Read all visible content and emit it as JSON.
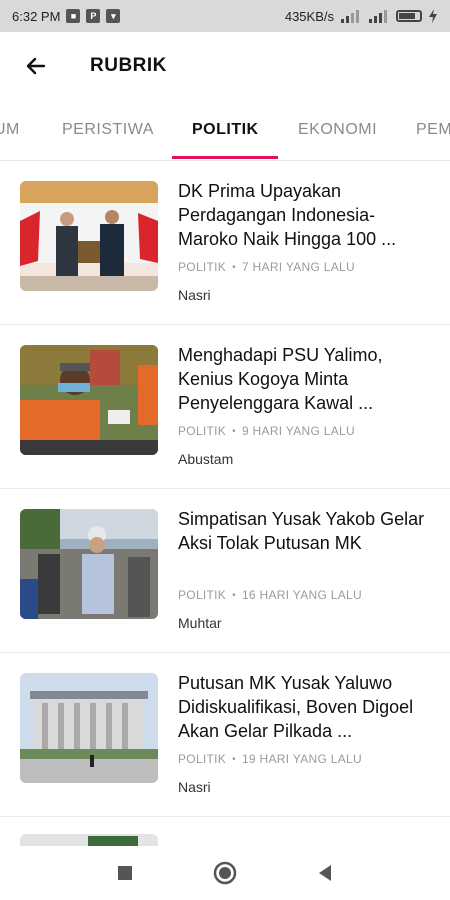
{
  "status_bar": {
    "time": "6:32 PM",
    "speed": "435KB/s",
    "network_label": "4G"
  },
  "app_bar": {
    "title": "RUBRIK",
    "back_icon": "arrow-left-icon"
  },
  "tabs": [
    {
      "label": "UM",
      "active": false
    },
    {
      "label": "PERISTIWA",
      "active": false
    },
    {
      "label": "POLITIK",
      "active": true
    },
    {
      "label": "EKONOMI",
      "active": false
    },
    {
      "label": "PEM",
      "active": false
    }
  ],
  "articles": [
    {
      "title": "DK Prima Upayakan Perdagangan Indonesia-Maroko Naik Hingga 100 ...",
      "category": "POLITIK",
      "time": "7 HARI YANG LALU",
      "author": "Nasri"
    },
    {
      "title": "Menghadapi PSU Yalimo, Kenius Kogoya Minta Penyelenggara Kawal ...",
      "category": "POLITIK",
      "time": "9 HARI YANG LALU",
      "author": "Abustam"
    },
    {
      "title": "Simpatisan Yusak Yakob Gelar Aksi Tolak Putusan MK",
      "category": "POLITIK",
      "time": "16 HARI YANG LALU",
      "author": "Muhtar"
    },
    {
      "title": "Putusan MK  Yusak Yaluwo Didiskualifikasi, Boven Digoel Akan Gelar Pilkada ...",
      "category": "POLITIK",
      "time": "19 HARI YANG LALU",
      "author": "Nasri"
    }
  ],
  "meta_separator": "•",
  "colors": {
    "accent": "#e0115f",
    "text": "#111111",
    "muted": "#9b9b9b"
  }
}
